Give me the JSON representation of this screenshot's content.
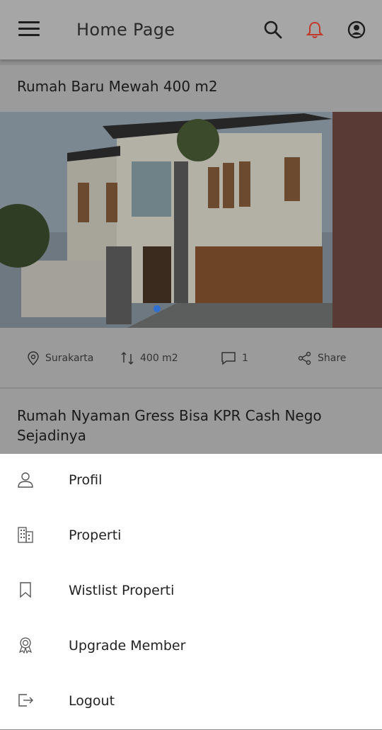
{
  "appbar": {
    "title": "Home Page"
  },
  "listing1": {
    "title": "Rumah Baru Mewah 400 m2",
    "location": "Surakarta",
    "area": "400 m2",
    "comments": "1",
    "share_label": "Share"
  },
  "listing2": {
    "title": "Rumah Nyaman Gress Bisa KPR Cash Nego Sejadinya"
  },
  "menu": {
    "items": [
      {
        "label": "Profil",
        "icon": "person-icon"
      },
      {
        "label": "Properti",
        "icon": "building-icon"
      },
      {
        "label": "Wistlist Properti",
        "icon": "bookmark-icon"
      },
      {
        "label": "Upgrade Member",
        "icon": "award-icon"
      },
      {
        "label": "Logout",
        "icon": "logout-icon"
      }
    ]
  },
  "colors": {
    "notification": "#c0392b",
    "overlay": "#8f8f8f"
  }
}
